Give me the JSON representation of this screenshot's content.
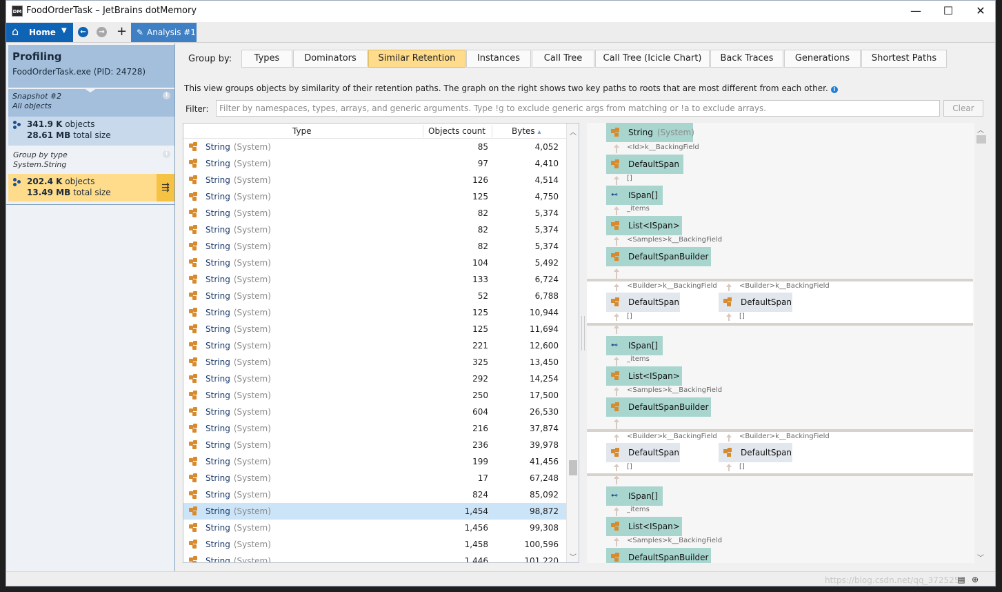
{
  "window": {
    "icon_text": "DM",
    "title": "FoodOrderTask – JetBrains dotMemory",
    "minimize_icon": "minimize-icon",
    "maximize_icon": "maximize-icon",
    "close_icon": "close-icon"
  },
  "nav": {
    "home_label": "Home",
    "analysis_label": "Analysis #1",
    "plus": "+"
  },
  "sidebar": {
    "profiling_title": "Profiling",
    "process": "FoodOrderTask.exe (PID: 24728)",
    "snapshot_title": "Snapshot #2",
    "snapshot_subtitle": "All objects",
    "snapshot_objects_value": "341.9 K",
    "snapshot_objects_label": "objects",
    "snapshot_size_value": "28.61 MB",
    "snapshot_size_label": "total size",
    "group_title": "Group by type",
    "group_subtitle": "System.String",
    "group_objects_value": "202.4 K",
    "group_objects_label": "objects",
    "group_size_value": "13.49 MB",
    "group_size_label": "total size"
  },
  "groupby": {
    "label": "Group by:",
    "tabs": [
      "Types",
      "Dominators",
      "Similar Retention",
      "Instances",
      "Call Tree",
      "Call Tree (Icicle Chart)",
      "Back Traces",
      "Generations",
      "Shortest Paths"
    ],
    "active": "Similar Retention"
  },
  "hint": "This view groups objects by similarity of their retention paths. The graph on the right shows two key paths to roots that are most different from each other.",
  "filter": {
    "label": "Filter:",
    "placeholder": "Filter by namespaces, types, arrays, and generic arguments. Type !g to exclude generic args from matching or !a to exclude arrays.",
    "clear_label": "Clear"
  },
  "table": {
    "columns": [
      "Type",
      "Objects count",
      "Bytes"
    ],
    "sort_indicator": "▴",
    "rows": [
      {
        "type": "String",
        "ns": "(System)",
        "count": "85",
        "bytes": "4,052"
      },
      {
        "type": "String",
        "ns": "(System)",
        "count": "97",
        "bytes": "4,410"
      },
      {
        "type": "String",
        "ns": "(System)",
        "count": "126",
        "bytes": "4,514"
      },
      {
        "type": "String",
        "ns": "(System)",
        "count": "125",
        "bytes": "4,750"
      },
      {
        "type": "String",
        "ns": "(System)",
        "count": "82",
        "bytes": "5,374"
      },
      {
        "type": "String",
        "ns": "(System)",
        "count": "82",
        "bytes": "5,374"
      },
      {
        "type": "String",
        "ns": "(System)",
        "count": "82",
        "bytes": "5,374"
      },
      {
        "type": "String",
        "ns": "(System)",
        "count": "104",
        "bytes": "5,492"
      },
      {
        "type": "String",
        "ns": "(System)",
        "count": "133",
        "bytes": "6,724"
      },
      {
        "type": "String",
        "ns": "(System)",
        "count": "52",
        "bytes": "6,788"
      },
      {
        "type": "String",
        "ns": "(System)",
        "count": "125",
        "bytes": "10,944"
      },
      {
        "type": "String",
        "ns": "(System)",
        "count": "125",
        "bytes": "11,694"
      },
      {
        "type": "String",
        "ns": "(System)",
        "count": "221",
        "bytes": "12,600"
      },
      {
        "type": "String",
        "ns": "(System)",
        "count": "325",
        "bytes": "13,450"
      },
      {
        "type": "String",
        "ns": "(System)",
        "count": "292",
        "bytes": "14,254"
      },
      {
        "type": "String",
        "ns": "(System)",
        "count": "250",
        "bytes": "17,500"
      },
      {
        "type": "String",
        "ns": "(System)",
        "count": "604",
        "bytes": "26,530"
      },
      {
        "type": "String",
        "ns": "(System)",
        "count": "216",
        "bytes": "37,874"
      },
      {
        "type": "String",
        "ns": "(System)",
        "count": "236",
        "bytes": "39,978"
      },
      {
        "type": "String",
        "ns": "(System)",
        "count": "199",
        "bytes": "41,456"
      },
      {
        "type": "String",
        "ns": "(System)",
        "count": "17",
        "bytes": "67,248"
      },
      {
        "type": "String",
        "ns": "(System)",
        "count": "824",
        "bytes": "85,092"
      },
      {
        "type": "String",
        "ns": "(System)",
        "count": "1,454",
        "bytes": "98,872",
        "selected": true
      },
      {
        "type": "String",
        "ns": "(System)",
        "count": "1,456",
        "bytes": "99,308"
      },
      {
        "type": "String",
        "ns": "(System)",
        "count": "1,458",
        "bytes": "100,596"
      },
      {
        "type": "String",
        "ns": "(System)",
        "count": "1,446",
        "bytes": "101,220"
      }
    ]
  },
  "graph": {
    "root_node": {
      "label": "String",
      "ns": "(System)"
    },
    "edge_id": "<Id>k__BackingField",
    "node_defaultspan": "DefaultSpan",
    "edge_brackets": "[]",
    "node_ispan_array": "ISpan[]",
    "edge_items": "_items",
    "node_list": "List<ISpan>",
    "edge_samples": "<Samples>k__BackingField",
    "node_builder": "DefaultSpanBuilder",
    "edge_builder": "<Builder>k__BackingField"
  },
  "statusbar": {
    "watermark": "https://blog.csdn.net/qq_3725254"
  }
}
